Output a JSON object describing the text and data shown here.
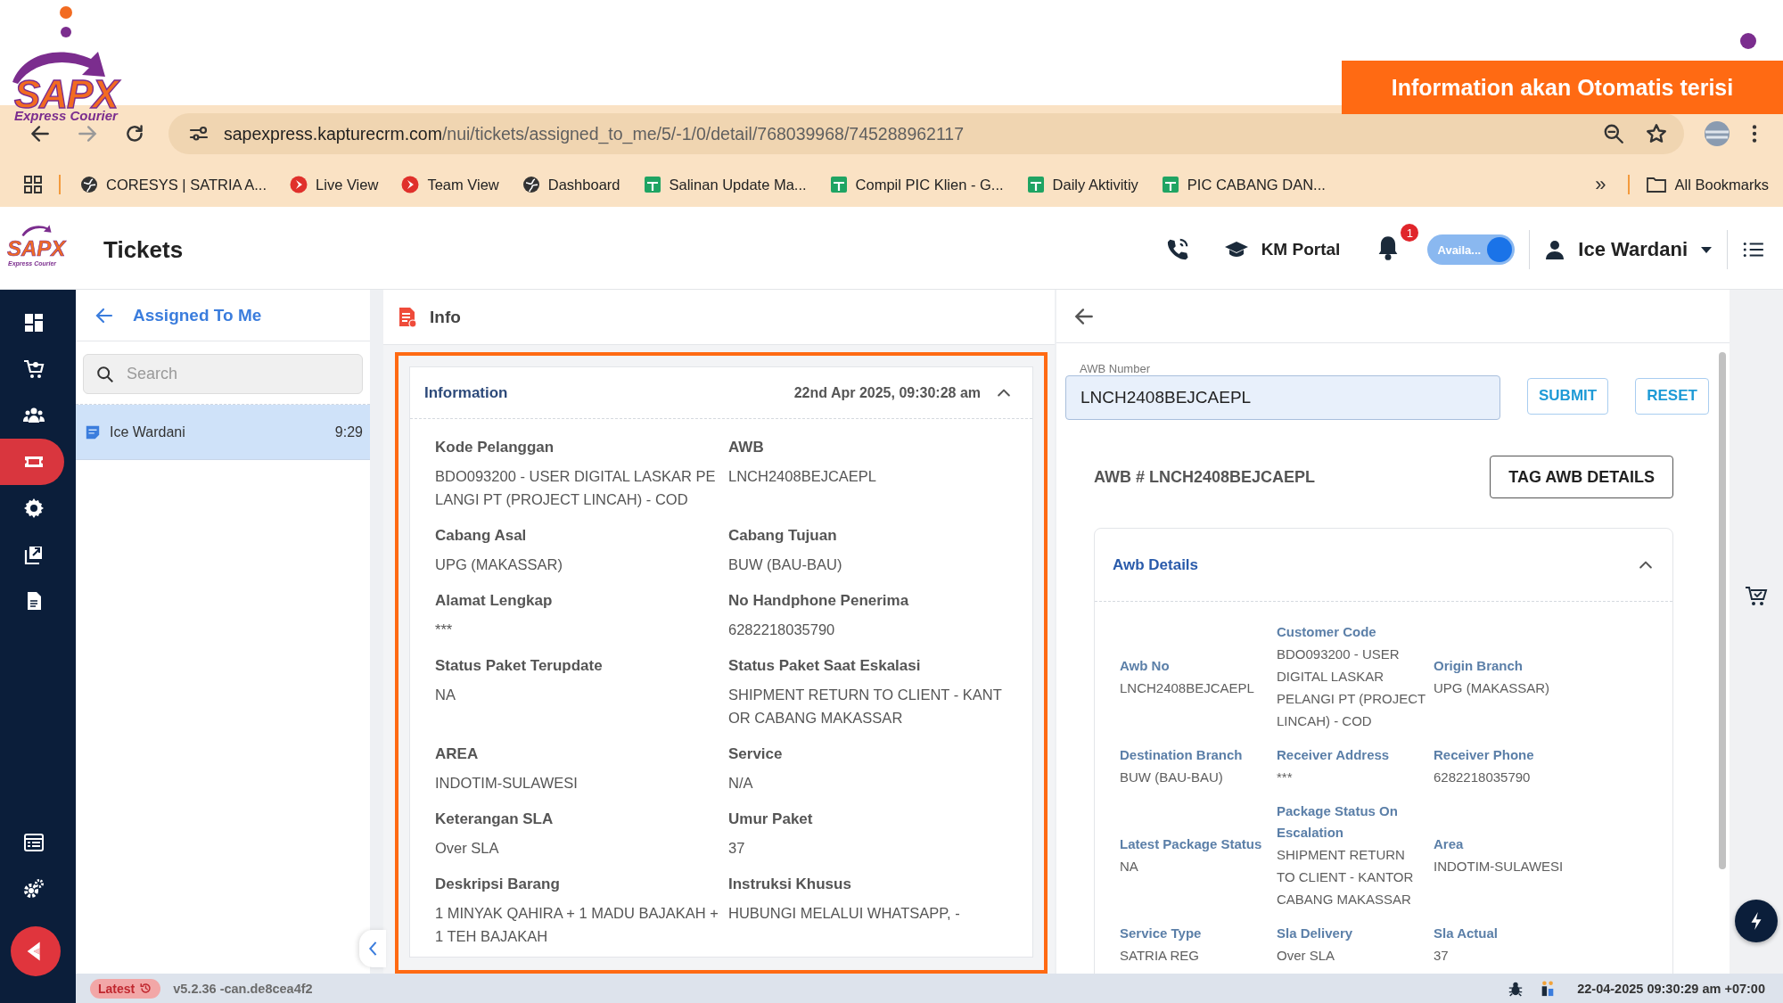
{
  "overlay": {
    "logo": {
      "name": "SAPX",
      "tagline": "Express Courier"
    },
    "banner": "Information akan Otomatis terisi"
  },
  "browser": {
    "url_host": "sapexpress.kapturecrm.com",
    "url_path": "/nui/tickets/assigned_to_me/5/-1/0/detail/768039968/745288962117",
    "bookmarks": [
      {
        "kind": "globe",
        "label": "CORESYS | SATRIA A..."
      },
      {
        "kind": "app",
        "label": "Live View"
      },
      {
        "kind": "app",
        "label": "Team View"
      },
      {
        "kind": "globe",
        "label": "Dashboard"
      },
      {
        "kind": "sheet",
        "label": "Salinan Update Ma..."
      },
      {
        "kind": "sheet",
        "label": "Compil PIC Klien - G..."
      },
      {
        "kind": "sheet",
        "label": "Daily Aktivitiy"
      },
      {
        "kind": "sheet",
        "label": "PIC CABANG DAN..."
      }
    ],
    "overflow": "»",
    "all_bookmarks": "All Bookmarks"
  },
  "app_header": {
    "logo": {
      "name": "SAPX",
      "tagline": "Express Courier"
    },
    "title": "Tickets",
    "km_portal": "KM Portal",
    "notification_count": "1",
    "availability": {
      "label": "Availa...",
      "on": true
    },
    "user": "Ice Wardani"
  },
  "nav": {
    "items": [
      {
        "kind": "dashboard",
        "selected": false
      },
      {
        "kind": "cart",
        "selected": false
      },
      {
        "kind": "team",
        "selected": false
      },
      {
        "kind": "ticket",
        "selected": true
      },
      {
        "kind": "settings",
        "selected": false
      },
      {
        "kind": "export",
        "selected": false
      },
      {
        "kind": "document",
        "selected": false
      }
    ],
    "bottom_items": [
      {
        "kind": "table",
        "selected": false
      },
      {
        "kind": "gears",
        "selected": false
      }
    ]
  },
  "list_panel": {
    "title": "Assigned To Me",
    "search": {
      "placeholder": "Search"
    },
    "items": [
      {
        "name": "Ice Wardani",
        "time": "9:29",
        "selected": true
      }
    ]
  },
  "info_panel": {
    "title": "Info",
    "card": {
      "title": "Information",
      "timestamp": "22nd Apr 2025, 09:30:28 am",
      "expanded": true,
      "fields": [
        {
          "label": "Kode Pelanggan",
          "value": "BDO093200 - USER DIGITAL LASKAR PELANGI PT (PROJECT LINCAH) - COD"
        },
        {
          "label": "AWB",
          "value": "LNCH2408BEJCAEPL"
        },
        {
          "label": "Cabang Asal",
          "value": "UPG (MAKASSAR)"
        },
        {
          "label": "Cabang Tujuan",
          "value": "BUW (BAU-BAU)"
        },
        {
          "label": "Alamat Lengkap",
          "value": "***"
        },
        {
          "label": "No Handphone Penerima",
          "value": "6282218035790"
        },
        {
          "label": "Status Paket Terupdate",
          "value": "NA"
        },
        {
          "label": "Status Paket Saat Eskalasi",
          "value": "SHIPMENT RETURN TO CLIENT - KANTOR CABANG MAKASSAR"
        },
        {
          "label": "AREA",
          "value": "INDOTIM-SULAWESI"
        },
        {
          "label": "Service",
          "value": "N/A"
        },
        {
          "label": "Keterangan SLA",
          "value": "Over SLA"
        },
        {
          "label": "Umur Paket",
          "value": "37"
        },
        {
          "label": "Deskripsi Barang",
          "value": "1 MINYAK QAHIRA + 1 MADU BAJAKAH + 1 TEH BAJAKAH"
        },
        {
          "label": "Instruksi Khusus",
          "value": "HUBUNGI MELALUI WHATSAPP, -"
        }
      ]
    }
  },
  "awb_panel": {
    "awb_field": {
      "label": "AWB Number",
      "value": "LNCH2408BEJCAEPL"
    },
    "buttons": [
      "SUBMIT",
      "RESET"
    ],
    "heading": "AWB # LNCH2408BEJCAEPL",
    "tag_button": "TAG AWB DETAILS",
    "details": {
      "title": "Awb Details",
      "expanded": true,
      "fields": [
        {
          "label": "Awb No",
          "value": "LNCH2408BEJCAEPL"
        },
        {
          "label": "Customer Code",
          "value": "BDO093200 - USER DIGITAL LASKAR PELANGI PT (PROJECT LINCAH) - COD"
        },
        {
          "label": "Origin Branch",
          "value": "UPG (MAKASSAR)"
        },
        {
          "label": "Destination Branch",
          "value": "BUW (BAU-BAU)"
        },
        {
          "label": "Receiver Address",
          "value": "***"
        },
        {
          "label": "Receiver Phone",
          "value": "6282218035790"
        },
        {
          "label": "Latest Package Status",
          "value": "NA"
        },
        {
          "label": "Package Status On Escalation",
          "value": "SHIPMENT RETURN TO CLIENT - KANTOR CABANG MAKASSAR"
        },
        {
          "label": "Area",
          "value": "INDOTIM-SULAWESI"
        },
        {
          "label": "Service Type",
          "value": "SATRIA REG"
        },
        {
          "label": "Sla Delivery",
          "value": "Over SLA"
        },
        {
          "label": "Sla Actual",
          "value": "37"
        }
      ]
    }
  },
  "footer": {
    "badge": "Latest",
    "version": "v5.2.36 -can.de8cea4f2",
    "datetime": "22-04-2025 09:30:29 am +07:00"
  }
}
